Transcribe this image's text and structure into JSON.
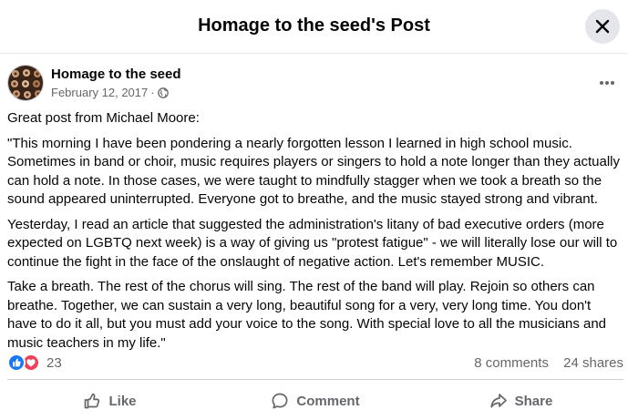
{
  "header": {
    "title": "Homage to the seed's Post"
  },
  "post": {
    "author": "Homage to the seed",
    "date": "February 12, 2017",
    "separator": "·",
    "paragraphs": [
      "Great post from Michael Moore:",
      " \"This morning I have been pondering a nearly forgotten lesson I learned in high school music. Sometimes in band or choir, music requires players or singers to hold a note longer than they actually can hold a note. In those cases, we were taught to mindfully stagger when we took a breath so the sound appeared uninterrupted. Everyone got to breathe, and the music stayed strong and vibrant.",
      "Yesterday, I read an article that suggested the administration's litany of bad executive orders (more expected on LGBTQ next week) is a way of giving us \"protest fatigue\" - we will literally lose our will to continue the fight in the face of the onslaught of negative action. Let's remember MUSIC.",
      "Take a breath. The rest of the chorus will sing. The rest of the band will play. Rejoin so others can breathe. Together, we can sustain a very long, beautiful song for a very, very long time. You don't have to do it all, but you must add your voice to the song. With special love to all the musicians and music teachers in my life.\""
    ]
  },
  "stats": {
    "reaction_count": "23",
    "comments": "8 comments",
    "shares": "24 shares"
  },
  "actions": {
    "like": "Like",
    "comment": "Comment",
    "share": "Share"
  },
  "icons": {
    "close": "close-icon",
    "more": "more-horizontal-icon",
    "privacy": "globe-icon",
    "like_reaction": "like-reaction-icon",
    "love_reaction": "love-reaction-icon",
    "like_action": "thumbs-up-icon",
    "comment_action": "comment-bubble-icon",
    "share_action": "share-arrow-icon"
  },
  "colors": {
    "like_blue": "#1877f2",
    "love_red": "#f33e58",
    "secondary_text": "#65676b",
    "divider": "#ced0d4"
  }
}
